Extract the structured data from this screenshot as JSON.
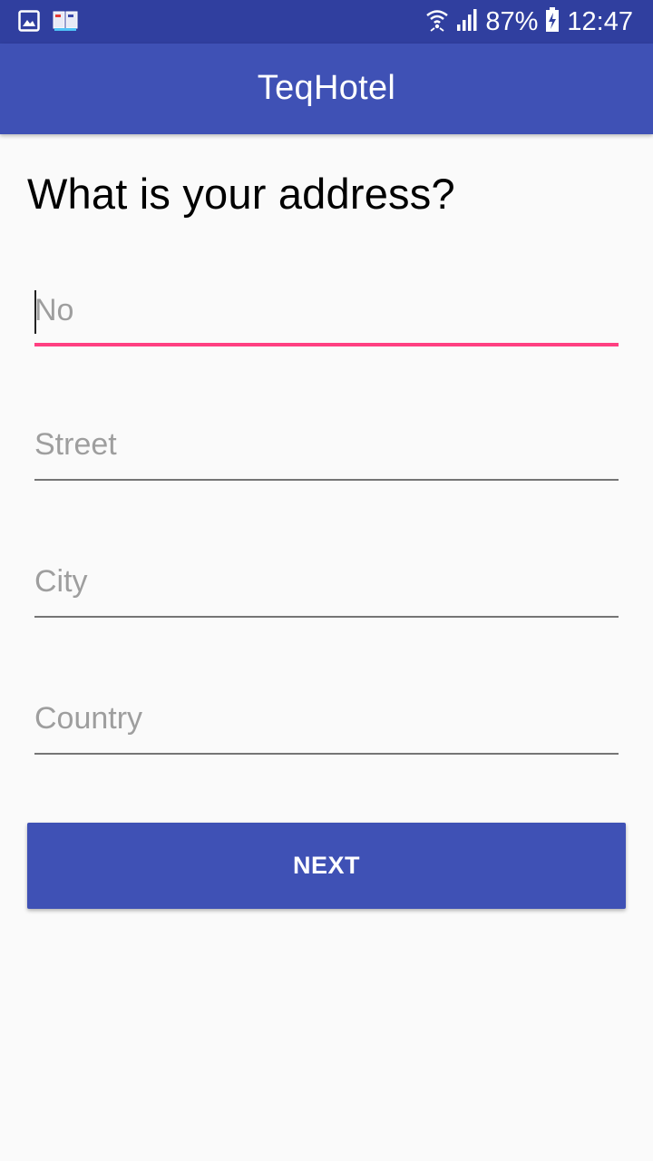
{
  "status_bar": {
    "battery_percent": "87%",
    "time": "12:47",
    "icons": [
      "gallery-icon",
      "book-app-icon",
      "wifi-icon",
      "signal-icon",
      "battery-charging-icon"
    ]
  },
  "app_bar": {
    "title": "TeqHotel"
  },
  "form": {
    "question": "What is your address?",
    "no_placeholder": "No",
    "street_placeholder": "Street",
    "city_placeholder": "City",
    "country_placeholder": "Country",
    "next_label": "NEXT"
  },
  "colors": {
    "status_bar": "#303f9f",
    "primary": "#3f51b5",
    "accent": "#ff4081"
  }
}
